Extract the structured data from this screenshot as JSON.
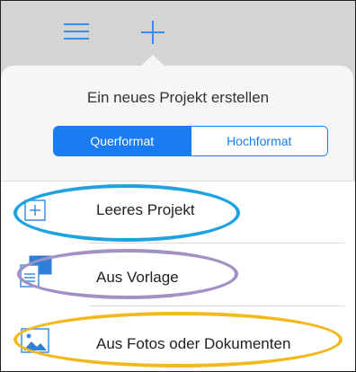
{
  "toolbar": {
    "menu_icon": "hamburger-menu-icon",
    "add_icon": "plus-icon"
  },
  "popover": {
    "title": "Ein neues Projekt erstellen",
    "orientation": {
      "options": [
        "Querformat",
        "Hochformat"
      ],
      "selected": "Querformat"
    },
    "items": [
      {
        "label": "Leeres Projekt",
        "icon": "plus-square-icon",
        "highlight_color": "#1fa3e0"
      },
      {
        "label": "Aus Vorlage",
        "icon": "template-pages-icon",
        "highlight_color": "#a191c4"
      },
      {
        "label": "Aus Fotos oder Dokumenten",
        "icon": "photo-icon",
        "highlight_color": "#f2b91e"
      }
    ]
  },
  "colors": {
    "accent": "#1a7cf2",
    "toolbar_bg": "#d4d4d4",
    "popover_bg": "#f6f6f6"
  }
}
